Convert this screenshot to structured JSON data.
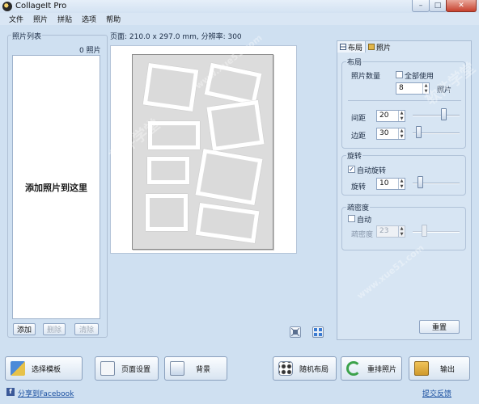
{
  "app": {
    "title": "CollageIt Pro"
  },
  "window_controls": {
    "minimize": "–",
    "maximize": "□",
    "close": "✕"
  },
  "menu": [
    "文件",
    "照片",
    "拼贴",
    "选项",
    "帮助"
  ],
  "photo_list": {
    "title": "照片列表",
    "count": "0 照片",
    "placeholder": "添加照片到这里",
    "add": "添加",
    "delete": "删除",
    "clear": "清除"
  },
  "canvas": {
    "info": "页面: 210.0 x 297.0 mm, 分辨率: 300"
  },
  "tabs": {
    "layout": "布局",
    "photo": "照片"
  },
  "layout_group": {
    "title": "布局",
    "photo_count_label": "照片数量",
    "use_all_label": "全部使用",
    "use_all_checked": false,
    "photo_count": "8",
    "photo_unit": "照片",
    "spacing_label": "间距",
    "spacing": "20",
    "margin_label": "边距",
    "margin": "30"
  },
  "rotation_group": {
    "title": "旋转",
    "auto_label": "自动旋转",
    "auto_checked": true,
    "rotate_label": "旋转",
    "rotate": "10"
  },
  "density_group": {
    "title": "疏密度",
    "auto_label": "自动",
    "auto_checked": false,
    "density_label": "疏密度",
    "density": "23"
  },
  "reset": "重置",
  "bottom_buttons": {
    "template": "选择模板",
    "page_setup": "页面设置",
    "background": "背景",
    "random_layout": "随机布局",
    "rearrange": "重排照片",
    "output": "输出"
  },
  "footer": {
    "share": "分享到Facebook",
    "feedback": "提交反馈"
  },
  "watermarks": [
    "软件学堂",
    "www.xue51.com"
  ],
  "colors": {
    "window_bg": "#cfe0f1",
    "page_bg": "#dcdcdc",
    "link": "#1a4fa0"
  }
}
